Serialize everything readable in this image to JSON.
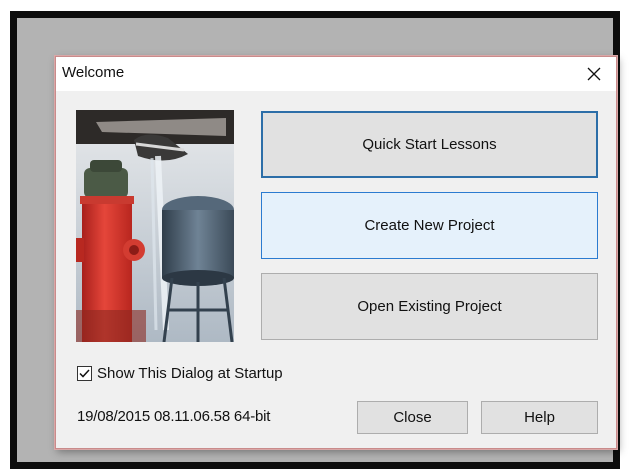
{
  "dialog": {
    "title": "Welcome",
    "close_icon": "close-icon",
    "picture_icon": "fire-hydrant-water-tower-illustration"
  },
  "buttons": {
    "quick_start": "Quick Start Lessons",
    "create_new": "Create New Project",
    "open_existing": "Open Existing Project",
    "close": "Close",
    "help": "Help"
  },
  "startup_option": {
    "label": "Show This Dialog at Startup",
    "checked": true
  },
  "version_info": "19/08/2015  08.11.06.58  64-bit",
  "colors": {
    "focus_border": "#2c6ea8",
    "hover_background": "#e5f1fb",
    "hover_border": "#2b7bd0",
    "dialog_background": "#f0f0f0"
  }
}
